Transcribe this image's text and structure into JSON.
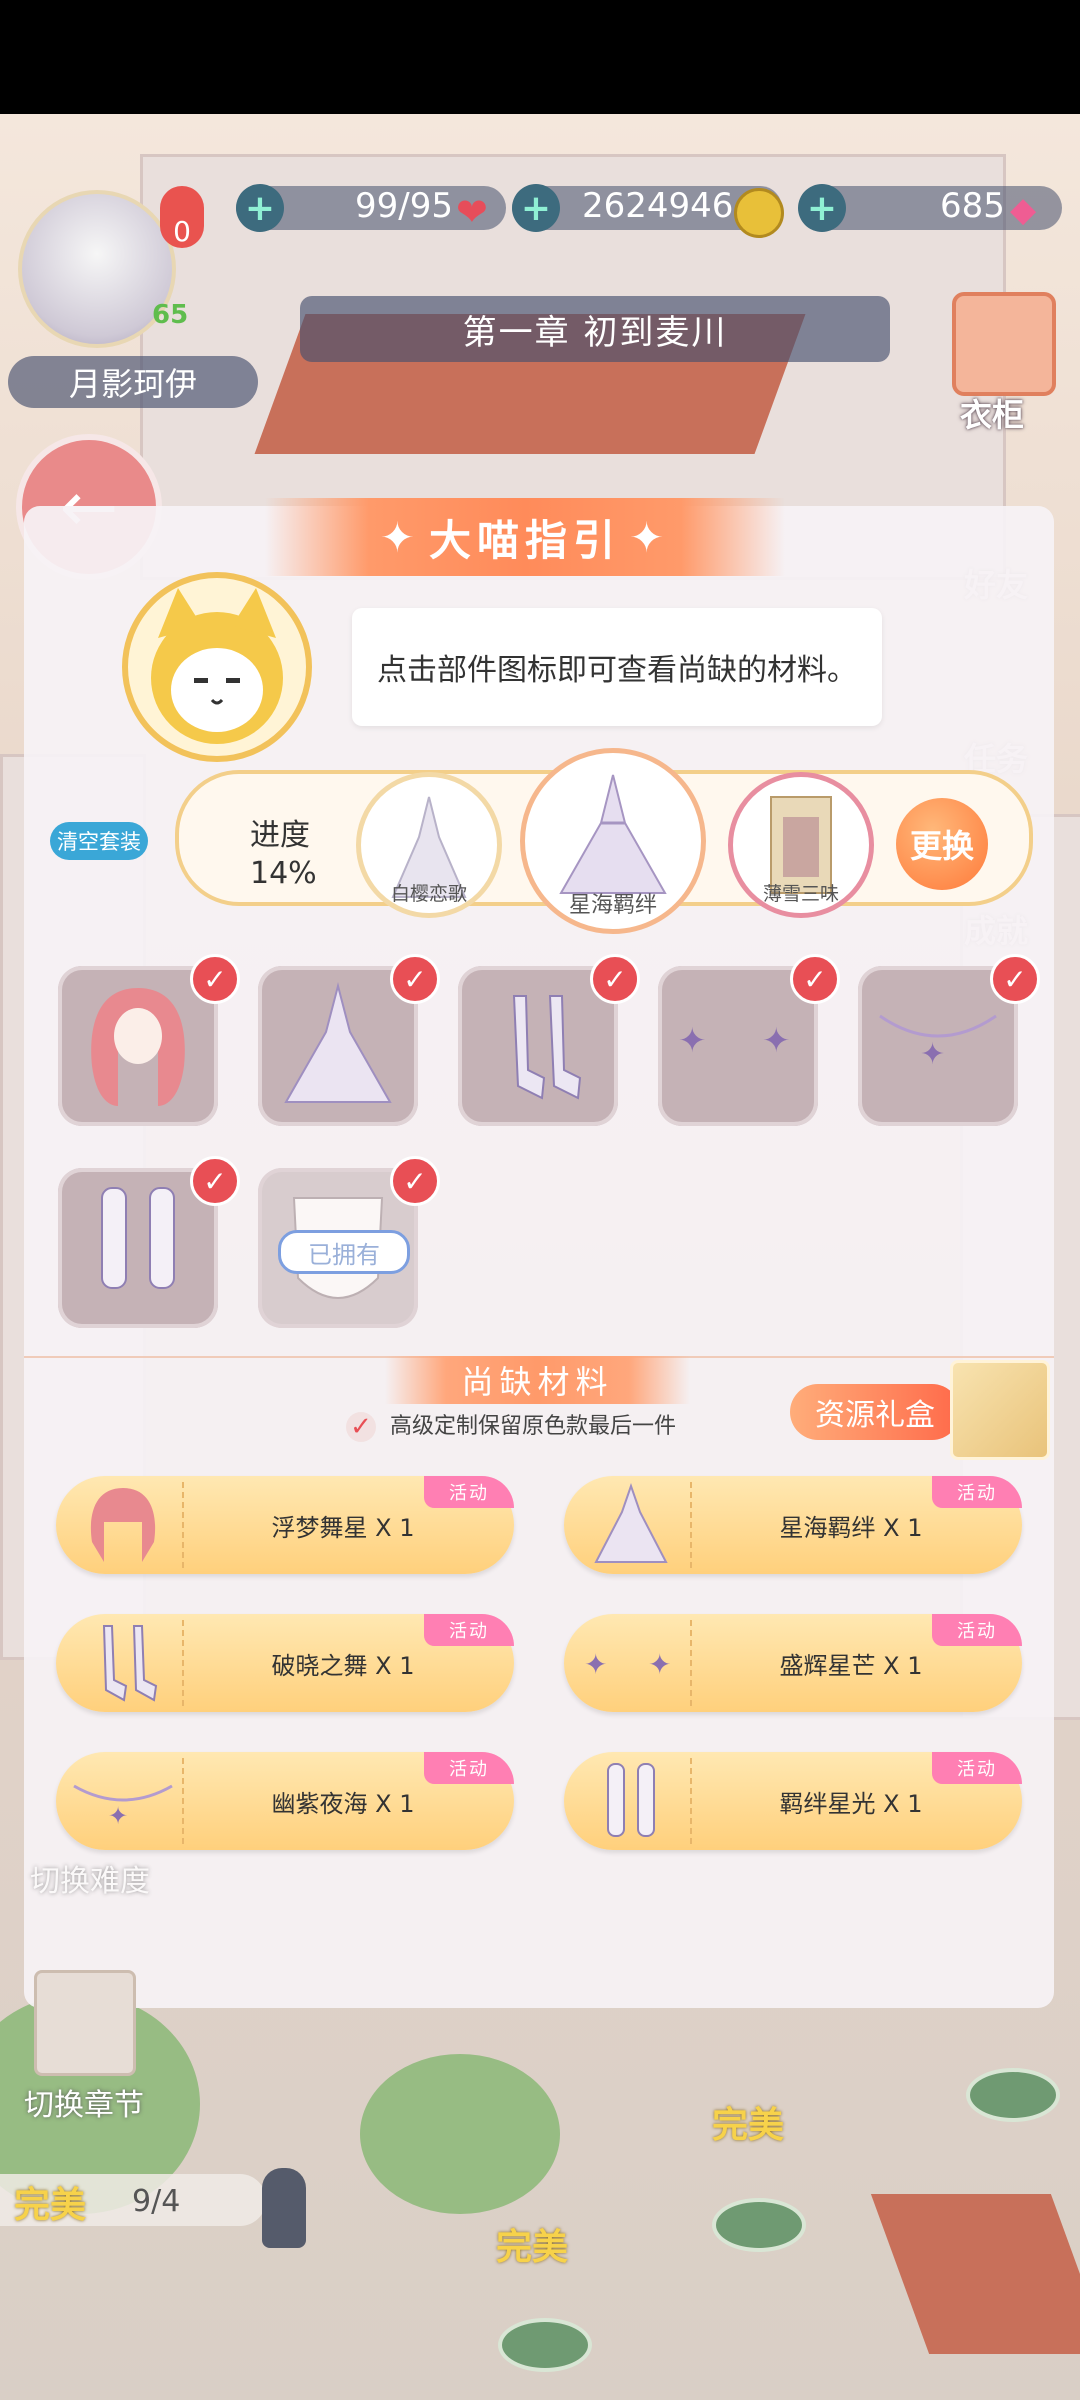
{
  "player": {
    "name": "月影珂伊",
    "level": "65",
    "vip": "0"
  },
  "resources": {
    "stamina": "99/95",
    "coins": "2624946",
    "diamonds": "685"
  },
  "chapter_title": "第一章 初到麦川",
  "side_menu": [
    "衣柜",
    "好友",
    "任务",
    "成就"
  ],
  "dialog": {
    "title": "大喵指引",
    "hint": "点击部件图标即可查看尚缺的材料。",
    "clear_label": "清空套装",
    "progress_label": "进度",
    "progress_value": "14%",
    "swap_label": "更换",
    "outfits": [
      {
        "name": "白樱恋歌"
      },
      {
        "name": "星海羁绊"
      },
      {
        "name": "薄雪三味"
      }
    ],
    "owned_label": "已拥有",
    "missing_title": "尚缺材料",
    "keep_option": "高级定制保留原色款最后一件",
    "gift_label": "资源礼盒",
    "activity_tag": "活动",
    "materials": [
      {
        "name": "浮梦舞星 X 1"
      },
      {
        "name": "星海羁绊 X 1"
      },
      {
        "name": "破晓之舞 X 1"
      },
      {
        "name": "盛辉星芒 X 1"
      },
      {
        "name": "幽紫夜海 X 1"
      },
      {
        "name": "羁绊星光 X 1"
      }
    ]
  },
  "bottom": {
    "switch_difficulty": "切换难度",
    "switch_chapter": "切换章节",
    "perfect": "完美",
    "stage_count": "9/4"
  }
}
